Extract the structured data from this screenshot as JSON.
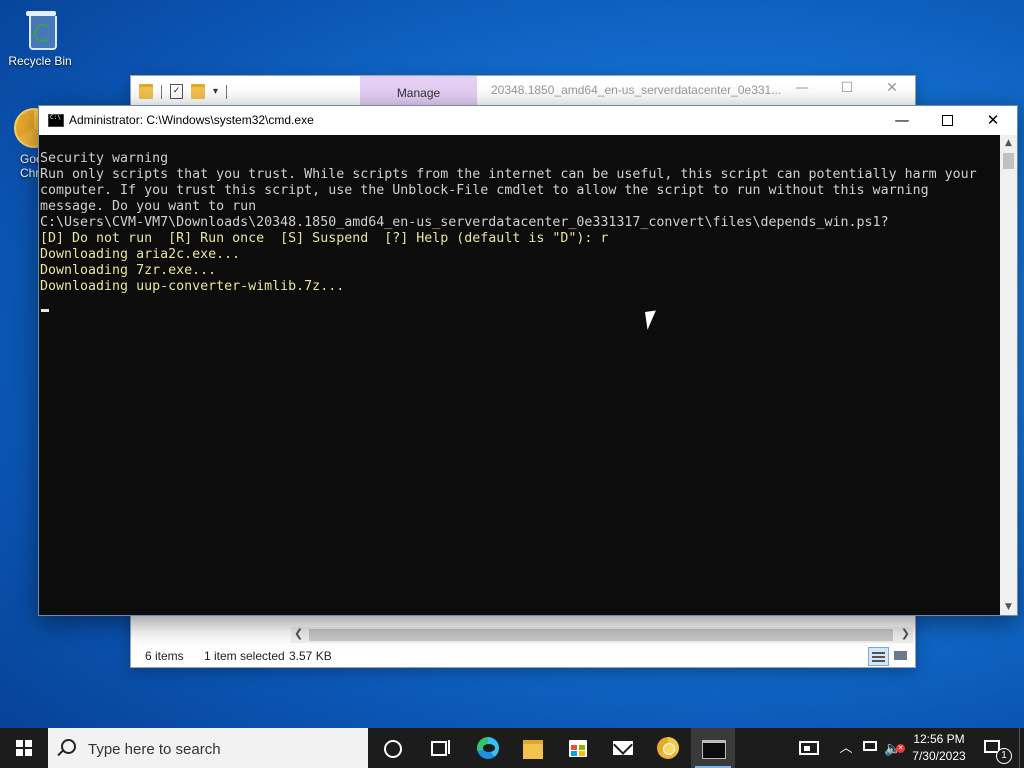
{
  "desktop": {
    "icons": [
      {
        "label": "Recycle Bin",
        "icon": "recycle-bin-icon"
      },
      {
        "label": "Goo\nChr",
        "icon": "chrome-icon"
      }
    ]
  },
  "explorer": {
    "ribbon_tab": "Manage",
    "path_title": "20348.1850_amd64_en-us_serverdatacenter_0e331...",
    "controls": {
      "minimize": "—",
      "maximize": "☐",
      "close": "✕"
    },
    "status": {
      "items_count": "6 items",
      "selection": "1 item selected",
      "size": "3.57 KB"
    }
  },
  "cmd": {
    "title": "Administrator: C:\\Windows\\system32\\cmd.exe",
    "controls": {
      "minimize": "—",
      "close": "✕"
    },
    "lines": [
      {
        "text": "Security warning",
        "color": "#d0d0d0"
      },
      {
        "text": "Run only scripts that you trust. While scripts from the internet can be useful, this script can potentially harm your",
        "color": "#d0d0d0"
      },
      {
        "text": "computer. If you trust this script, use the Unblock-File cmdlet to allow the script to run without this warning",
        "color": "#d0d0d0"
      },
      {
        "text": "message. Do you want to run",
        "color": "#d0d0d0"
      },
      {
        "text": "C:\\Users\\CVM-VM7\\Downloads\\20348.1850_amd64_en-us_serverdatacenter_0e331317_convert\\files\\depends_win.ps1?",
        "color": "#d0d0d0"
      },
      {
        "text": "[D] Do not run  [R] Run once  [S] Suspend  [?] Help (default is \"D\"): r",
        "color": "#e7e49a"
      },
      {
        "text": "Downloading aria2c.exe...",
        "color": "#e7e49a"
      },
      {
        "text": "Downloading 7zr.exe...",
        "color": "#e7e49a"
      },
      {
        "text": "Downloading uup-converter-wimlib.7z...",
        "color": "#e7e49a"
      }
    ]
  },
  "taskbar": {
    "search_placeholder": "Type here to search",
    "apps": [
      "cortana-icon",
      "task-view-icon",
      "edge-icon",
      "file-explorer-icon",
      "store-icon",
      "mail-icon",
      "chrome-icon",
      "cmd-icon"
    ],
    "clock": {
      "time": "12:56 PM",
      "date": "7/30/2023"
    },
    "notifications_count": "1"
  }
}
